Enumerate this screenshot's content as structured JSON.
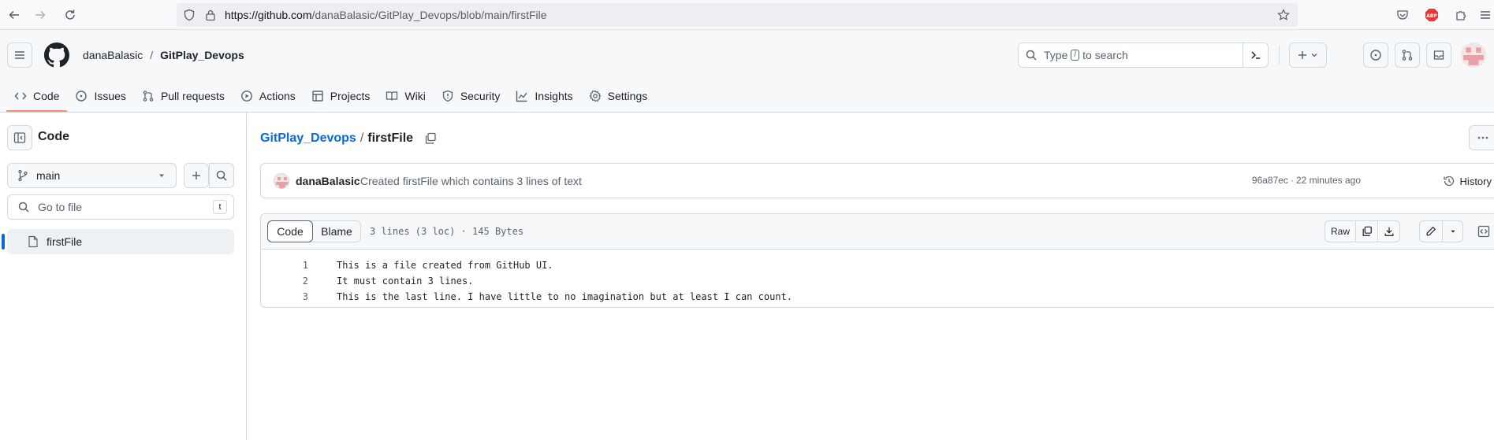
{
  "browser": {
    "url_host": "https://github.com",
    "url_path": "/danaBalasic/GitPlay_Devops/blob/main/firstFile"
  },
  "header": {
    "owner": "danaBalasic",
    "separator": "/",
    "repo": "GitPlay_Devops",
    "search_prefix": "Type",
    "search_key": "/",
    "search_suffix": "to search"
  },
  "tabs": [
    {
      "label": "Code",
      "icon": "code-icon"
    },
    {
      "label": "Issues",
      "icon": "issue-icon"
    },
    {
      "label": "Pull requests",
      "icon": "pull-request-icon"
    },
    {
      "label": "Actions",
      "icon": "play-icon"
    },
    {
      "label": "Projects",
      "icon": "table-icon"
    },
    {
      "label": "Wiki",
      "icon": "book-icon"
    },
    {
      "label": "Security",
      "icon": "shield-icon"
    },
    {
      "label": "Insights",
      "icon": "graph-icon"
    },
    {
      "label": "Settings",
      "icon": "gear-icon"
    }
  ],
  "sidebar": {
    "title": "Code",
    "branch": "main",
    "go_to_file_placeholder": "Go to file",
    "go_to_file_key": "t",
    "files": [
      {
        "name": "firstFile",
        "selected": true
      }
    ]
  },
  "breadcrumb": {
    "repo": "GitPlay_Devops",
    "separator": "/",
    "file": "firstFile"
  },
  "commit": {
    "author": "danaBalasic",
    "message": "Created firstFile which contains 3 lines of text",
    "sha": "96a87ec",
    "separator": "·",
    "time": "22 minutes ago",
    "history_label": "History"
  },
  "file_view": {
    "code_tab": "Code",
    "blame_tab": "Blame",
    "info": "3 lines (3 loc) · 145 Bytes",
    "raw_label": "Raw",
    "lines": [
      {
        "num": "1",
        "text": "This is a file created from GitHub UI."
      },
      {
        "num": "2",
        "text": "It must contain 3 lines."
      },
      {
        "num": "3",
        "text": "This is the last line. I have little to no imagination but at least I can count."
      }
    ]
  },
  "colors": {
    "link": "#0969da",
    "active_tab_underline": "#fd8c73",
    "selected_file_marker": "#0969da"
  }
}
